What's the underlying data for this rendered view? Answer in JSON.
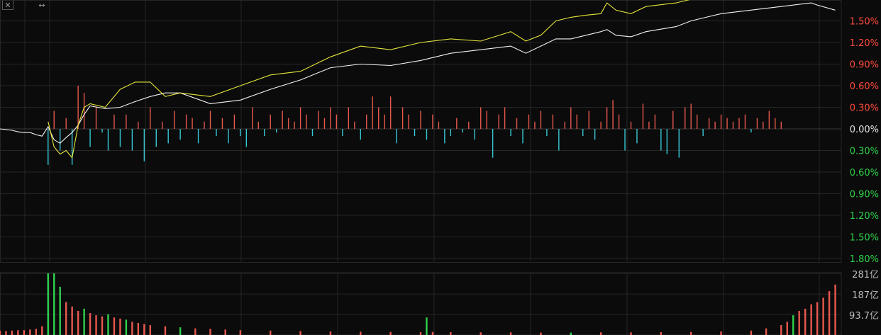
{
  "toolbar": {
    "close_icon": "close-icon",
    "expand_icon": "horizontal-expand-icon"
  },
  "colors": {
    "background": "#0b0b0b",
    "grid": "#262626",
    "index_line": "#f2f2f2",
    "leading_line": "#e6e63c",
    "up": "#e8584e",
    "down": "#37c8d6",
    "up_label": "#ff4a3d",
    "down_label": "#2fd24b",
    "zero_label": "#e6e6e6",
    "volume_label": "#bdbdbd"
  },
  "chart_data": [
    {
      "type": "line",
      "title": "",
      "xlabel": "",
      "ylabel": "",
      "ylim": [
        -1.8,
        1.8
      ],
      "y_tick_labels": [
        "1.50%",
        "1.20%",
        "0.90%",
        "0.60%",
        "0.30%",
        "0.00%",
        "0.30%",
        "0.60%",
        "0.90%",
        "1.20%",
        "1.50%",
        "1.80%"
      ],
      "y_tick_values": [
        1.5,
        1.2,
        0.9,
        0.6,
        0.3,
        0.0,
        -0.3,
        -0.6,
        -0.9,
        -1.2,
        -1.5,
        -1.8
      ],
      "grid": true,
      "series": [
        {
          "key": "index",
          "x": [
            0,
            2,
            4,
            6,
            8,
            10,
            12,
            14,
            16,
            18,
            20,
            22,
            24,
            26,
            28,
            30,
            35,
            40,
            45,
            50,
            55,
            60,
            70,
            80,
            90,
            100,
            110,
            120,
            130,
            140,
            150,
            160,
            170,
            175,
            180,
            185,
            190,
            195,
            200,
            202,
            205,
            210,
            215,
            225,
            230,
            235,
            240,
            260,
            270,
            272,
            278
          ],
          "values": [
            0.0,
            -0.01,
            -0.02,
            -0.04,
            -0.05,
            -0.05,
            -0.08,
            -0.1,
            0.03,
            -0.15,
            -0.2,
            -0.12,
            -0.05,
            0.05,
            0.2,
            0.32,
            0.28,
            0.3,
            0.38,
            0.45,
            0.5,
            0.5,
            0.35,
            0.4,
            0.55,
            0.68,
            0.85,
            0.9,
            0.88,
            0.95,
            1.05,
            1.1,
            1.15,
            1.05,
            1.15,
            1.25,
            1.25,
            1.3,
            1.35,
            1.38,
            1.3,
            1.28,
            1.35,
            1.42,
            1.5,
            1.55,
            1.6,
            1.7,
            1.75,
            1.72,
            1.65
          ]
        },
        {
          "key": "leading",
          "x": [
            16,
            18,
            20,
            22,
            24,
            26,
            28,
            30,
            35,
            40,
            45,
            50,
            55,
            60,
            70,
            80,
            90,
            100,
            110,
            120,
            130,
            140,
            150,
            160,
            170,
            175,
            180,
            185,
            190,
            195,
            200,
            202,
            205,
            210,
            215,
            225,
            230,
            235,
            240,
            255
          ],
          "values": [
            0.1,
            -0.25,
            -0.35,
            -0.3,
            -0.4,
            0.05,
            0.3,
            0.35,
            0.3,
            0.55,
            0.65,
            0.65,
            0.45,
            0.5,
            0.45,
            0.6,
            0.75,
            0.8,
            1.0,
            1.15,
            1.1,
            1.2,
            1.25,
            1.22,
            1.35,
            1.22,
            1.3,
            1.5,
            1.55,
            1.58,
            1.6,
            1.75,
            1.65,
            1.6,
            1.7,
            1.75,
            1.8,
            1.85,
            1.9,
            1.95
          ]
        }
      ],
      "bars": {
        "x": [
          16,
          18,
          20,
          22,
          24,
          26,
          28,
          30,
          32,
          34,
          36,
          38,
          40,
          42,
          44,
          46,
          48,
          50,
          52,
          54,
          56,
          58,
          60,
          62,
          64,
          66,
          68,
          70,
          72,
          74,
          76,
          78,
          80,
          82,
          84,
          86,
          88,
          90,
          92,
          94,
          96,
          98,
          100,
          102,
          104,
          106,
          108,
          110,
          112,
          114,
          116,
          118,
          120,
          122,
          124,
          126,
          128,
          130,
          132,
          134,
          136,
          138,
          140,
          142,
          144,
          146,
          148,
          150,
          152,
          154,
          156,
          158,
          160,
          162,
          164,
          166,
          168,
          170,
          172,
          174,
          176,
          178,
          180,
          182,
          184,
          186,
          188,
          190,
          192,
          194,
          196,
          198,
          200,
          202,
          204,
          206,
          208,
          210,
          212,
          214,
          216,
          218,
          220,
          222,
          224,
          226,
          228,
          230,
          232,
          234,
          236,
          238,
          240,
          242,
          244,
          246,
          248,
          250,
          252,
          254,
          256,
          258,
          260
        ],
        "values": [
          -0.5,
          0.25,
          -0.3,
          0.15,
          -0.5,
          0.6,
          0.5,
          -0.25,
          0.3,
          -0.05,
          -0.3,
          0.2,
          -0.25,
          0.2,
          -0.3,
          0.1,
          -0.45,
          0.3,
          -0.25,
          0.1,
          -0.2,
          0.25,
          -0.15,
          0.2,
          0.15,
          -0.2,
          0.1,
          0.25,
          -0.1,
          0.15,
          -0.2,
          0.2,
          -0.1,
          -0.25,
          0.3,
          0.1,
          -0.1,
          0.2,
          -0.05,
          0.25,
          0.15,
          0.1,
          0.3,
          0.2,
          -0.1,
          0.25,
          0.15,
          0.3,
          0.2,
          -0.1,
          0.3,
          0.1,
          -0.15,
          0.2,
          0.45,
          0.3,
          0.2,
          0.45,
          -0.2,
          0.3,
          0.2,
          -0.1,
          0.25,
          -0.15,
          0.2,
          0.1,
          -0.2,
          -0.1,
          0.15,
          -0.05,
          0.1,
          -0.15,
          0.3,
          0.25,
          -0.4,
          0.2,
          0.3,
          -0.1,
          0.15,
          -0.2,
          0.2,
          0.1,
          0.25,
          -0.1,
          0.2,
          -0.3,
          0.1,
          0.3,
          0.2,
          -0.1,
          0.25,
          -0.15,
          0.1,
          0.3,
          0.4,
          0.2,
          -0.3,
          0.1,
          -0.2,
          0.35,
          0.1,
          0.2,
          -0.3,
          -0.35,
          0.25,
          -0.4,
          0.3,
          0.35,
          0.2,
          -0.1,
          0.15,
          0.1,
          0.2,
          0.15,
          0.1,
          0.15,
          0.2,
          -0.05,
          0.15,
          0.1,
          0.25,
          0.15,
          0.1
        ]
      }
    },
    {
      "type": "bar",
      "title": "",
      "ylim": [
        0,
        281
      ],
      "y_tick_labels": [
        "281亿",
        "187亿",
        "93.7亿"
      ],
      "y_tick_values": [
        281,
        187,
        93.7
      ],
      "x": [
        0,
        2,
        4,
        6,
        8,
        10,
        12,
        14,
        16,
        18,
        20,
        22,
        24,
        26,
        28,
        30,
        32,
        34,
        36,
        38,
        40,
        42,
        44,
        46,
        48,
        50,
        55,
        60,
        65,
        70,
        75,
        80,
        90,
        100,
        110,
        120,
        130,
        140,
        142,
        144,
        150,
        160,
        170,
        180,
        190,
        200,
        210,
        220,
        230,
        240,
        250,
        255,
        260,
        262,
        264,
        266,
        268,
        270,
        272,
        274,
        276,
        278
      ],
      "values": [
        20,
        18,
        20,
        22,
        22,
        25,
        28,
        40,
        281,
        281,
        220,
        150,
        130,
        110,
        120,
        100,
        90,
        85,
        95,
        80,
        75,
        70,
        60,
        55,
        50,
        45,
        40,
        35,
        30,
        28,
        25,
        22,
        20,
        18,
        16,
        15,
        14,
        13,
        80,
        14,
        13,
        12,
        12,
        11,
        11,
        12,
        12,
        13,
        14,
        16,
        20,
        30,
        45,
        60,
        90,
        110,
        120,
        140,
        150,
        170,
        200,
        230
      ],
      "colors": [
        "up",
        "up",
        "up",
        "up",
        "up",
        "up",
        "up",
        "up",
        "down",
        "down",
        "down",
        "up",
        "up",
        "up",
        "down",
        "up",
        "up",
        "up",
        "down",
        "up",
        "up",
        "down",
        "up",
        "up",
        "up",
        "up",
        "up",
        "down",
        "up",
        "up",
        "up",
        "up",
        "up",
        "up",
        "up",
        "up",
        "up",
        "up",
        "down",
        "up",
        "up",
        "up",
        "up",
        "up",
        "down",
        "up",
        "up",
        "up",
        "up",
        "up",
        "up",
        "up",
        "up",
        "up",
        "down",
        "up",
        "up",
        "up",
        "up",
        "up",
        "up",
        "up"
      ]
    }
  ]
}
